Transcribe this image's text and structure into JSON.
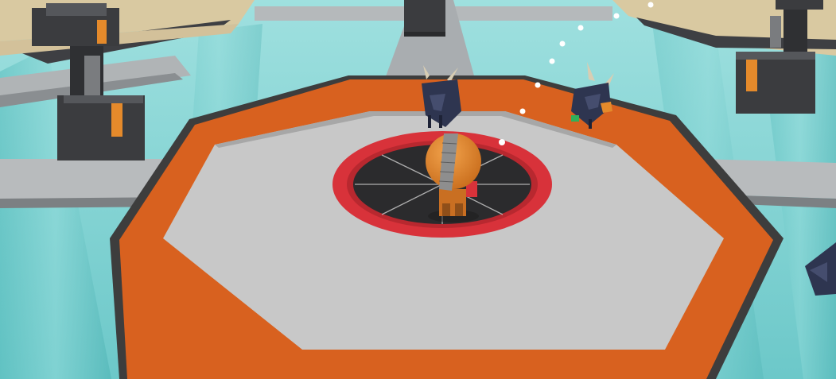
{
  "scene": {
    "colors": {
      "water": "#7fd3d4",
      "water_light": "#a9e4e3",
      "glass_pillar": "#4fb9ba",
      "walkway": "#9ea3a6",
      "walkway_top": "#c4c7c9",
      "frame": "#d9c9a1",
      "platform_floor": "#c8c8c8",
      "platform_trim": "#d8611f",
      "platform_edge": "#3d3d3d",
      "hatch_ring": "#d8323a",
      "hatch_floor": "#2b2b2d",
      "turret_body": "#3b3c3f",
      "turret_accent": "#e58a2b",
      "player_body": "#e2892d",
      "player_band": "#8e8e8e",
      "enemy_body": "#2e3550",
      "enemy_horn": "#d8cdb3",
      "projectile": "#ffffff"
    },
    "entities": {
      "player": "hero-with-orange-pack",
      "enemies": [
        "horned-beetle-left",
        "horned-beetle-right",
        "horned-beetle-edge"
      ],
      "turrets": [
        "turret-top-left",
        "turret-bottom-left",
        "turret-top-center",
        "turret-top-right",
        "turret-right"
      ],
      "projectiles": 8
    }
  }
}
